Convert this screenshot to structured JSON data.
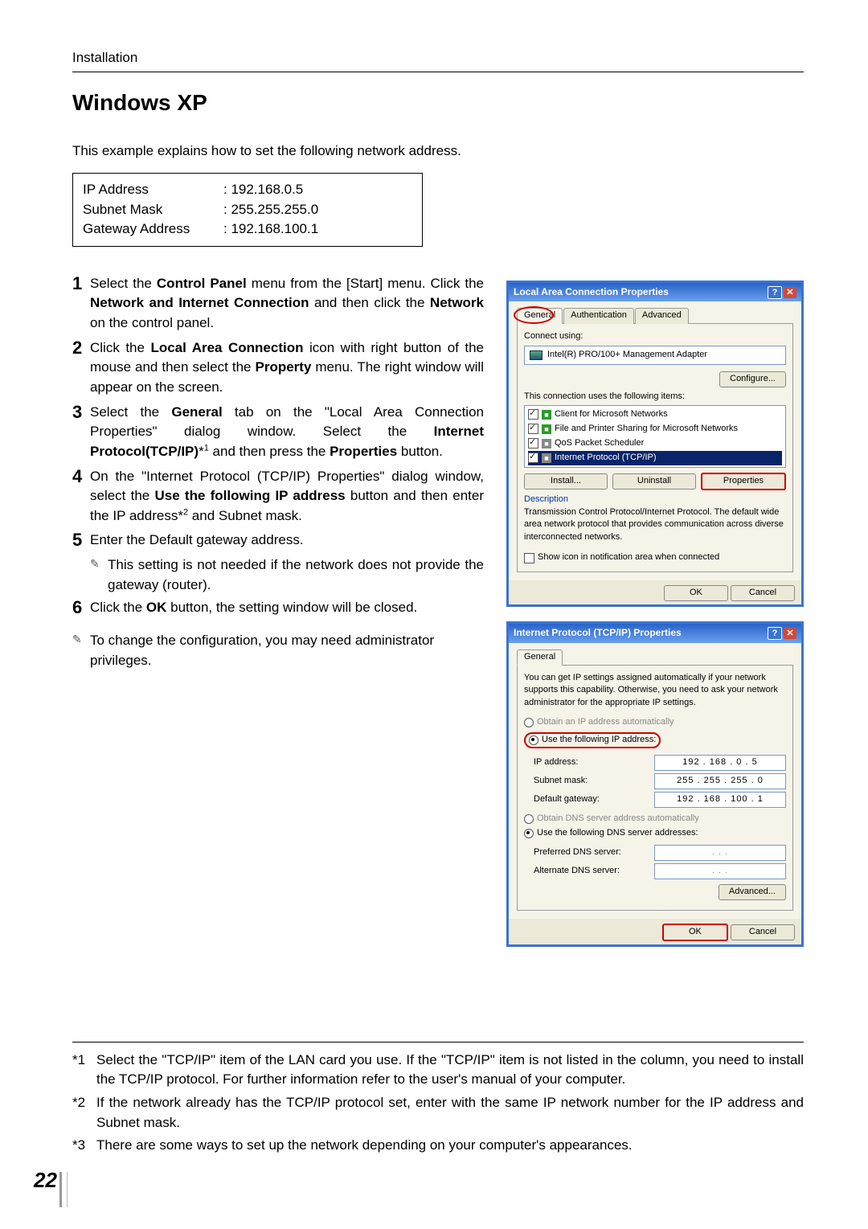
{
  "header": {
    "section": "Installation"
  },
  "title": "Windows XP",
  "intro": "This example explains how to set the following network address.",
  "ip_settings": {
    "rows": [
      {
        "label": "IP Address",
        "value": ": 192.168.0.5"
      },
      {
        "label": "Subnet Mask",
        "value": ": 255.255.255.0"
      },
      {
        "label": "Gateway Address",
        "value": ": 192.168.100.1"
      }
    ]
  },
  "steps": [
    {
      "n": "1",
      "body_html": "Select the <b>Control Panel</b> menu from the [Start] menu. Click the <b>Network and Internet Connection</b> and then click the <b>Network</b> on the control panel."
    },
    {
      "n": "2",
      "body_html": "Click the <b>Local Area Connection</b> icon with right button of the mouse and then select the <b>Property</b> menu. The right window will appear on the screen."
    },
    {
      "n": "3",
      "body_html": "Select the <b>General</b> tab on the \"Local Area Connection Properties\" dialog window.  Select the <b>Internet Protocol(TCP/IP)</b>*<sup>1</sup> and then press the <b>Properties</b> button."
    },
    {
      "n": "4",
      "body_html": "On the \"Internet Protocol (TCP/IP) Properties\" dialog window, select the <b>Use the following IP address</b> button and then enter the IP address*<sup>2</sup> and Subnet mask."
    },
    {
      "n": "5",
      "body_html": "Enter the Default gateway address.",
      "sub": "This setting is not needed if the network does not provide the gateway (router)."
    },
    {
      "n": "6",
      "body_html": "Click the <b>OK</b> button, the setting window will be closed."
    }
  ],
  "bottom_note": "To change the configuration, you may need administrator privileges.",
  "dialog1": {
    "title": "Local Area Connection Properties",
    "tabs": [
      "General",
      "Authentication",
      "Advanced"
    ],
    "connect_label": "Connect using:",
    "adapter": "Intel(R) PRO/100+ Management Adapter",
    "configure": "Configure...",
    "items_label": "This connection uses the following items:",
    "items": [
      "Client for Microsoft Networks",
      "File and Printer Sharing for Microsoft Networks",
      "QoS Packet Scheduler",
      "Internet Protocol (TCP/IP)"
    ],
    "btns": {
      "install": "Install...",
      "uninstall": "Uninstall",
      "properties": "Properties"
    },
    "desc_h": "Description",
    "desc": "Transmission Control Protocol/Internet Protocol. The default wide area network protocol that provides communication across diverse interconnected networks.",
    "show_icon": "Show icon in notification area when connected",
    "ok": "OK",
    "cancel": "Cancel"
  },
  "dialog2": {
    "title": "Internet Protocol (TCP/IP) Properties",
    "tab": "General",
    "intro": "You can get IP settings assigned automatically if your network supports this capability. Otherwise, you need to ask your network administrator for the appropriate IP settings.",
    "r1": "Obtain an IP address automatically",
    "r2": "Use the following IP address:",
    "ip_label": "IP address:",
    "ip_value": "192 . 168 .   0  .   5",
    "mask_label": "Subnet mask:",
    "mask_value": "255 . 255 . 255 .   0",
    "gw_label": "Default gateway:",
    "gw_value": "192 . 168 . 100 .   1",
    "r3": "Obtain DNS server address automatically",
    "r4": "Use the following DNS server addresses:",
    "dns1_label": "Preferred DNS server:",
    "dns1_value": ".       .       .",
    "dns2_label": "Alternate DNS server:",
    "dns2_value": ".       .       .",
    "advanced": "Advanced...",
    "ok": "OK",
    "cancel": "Cancel"
  },
  "footnotes": [
    {
      "m": "*1",
      "t": "Select the \"TCP/IP\" item of the LAN card you use. If the \"TCP/IP\" item is not listed in the column, you need to install the TCP/IP protocol. For further information refer to the user's manual of your computer."
    },
    {
      "m": "*2",
      "t": "If the network already has the TCP/IP protocol set, enter with the same IP network number for the IP address and Subnet mask."
    },
    {
      "m": "*3",
      "t": "There are some ways to set up the network depending on your computer's appearances."
    }
  ],
  "page_number": "22"
}
